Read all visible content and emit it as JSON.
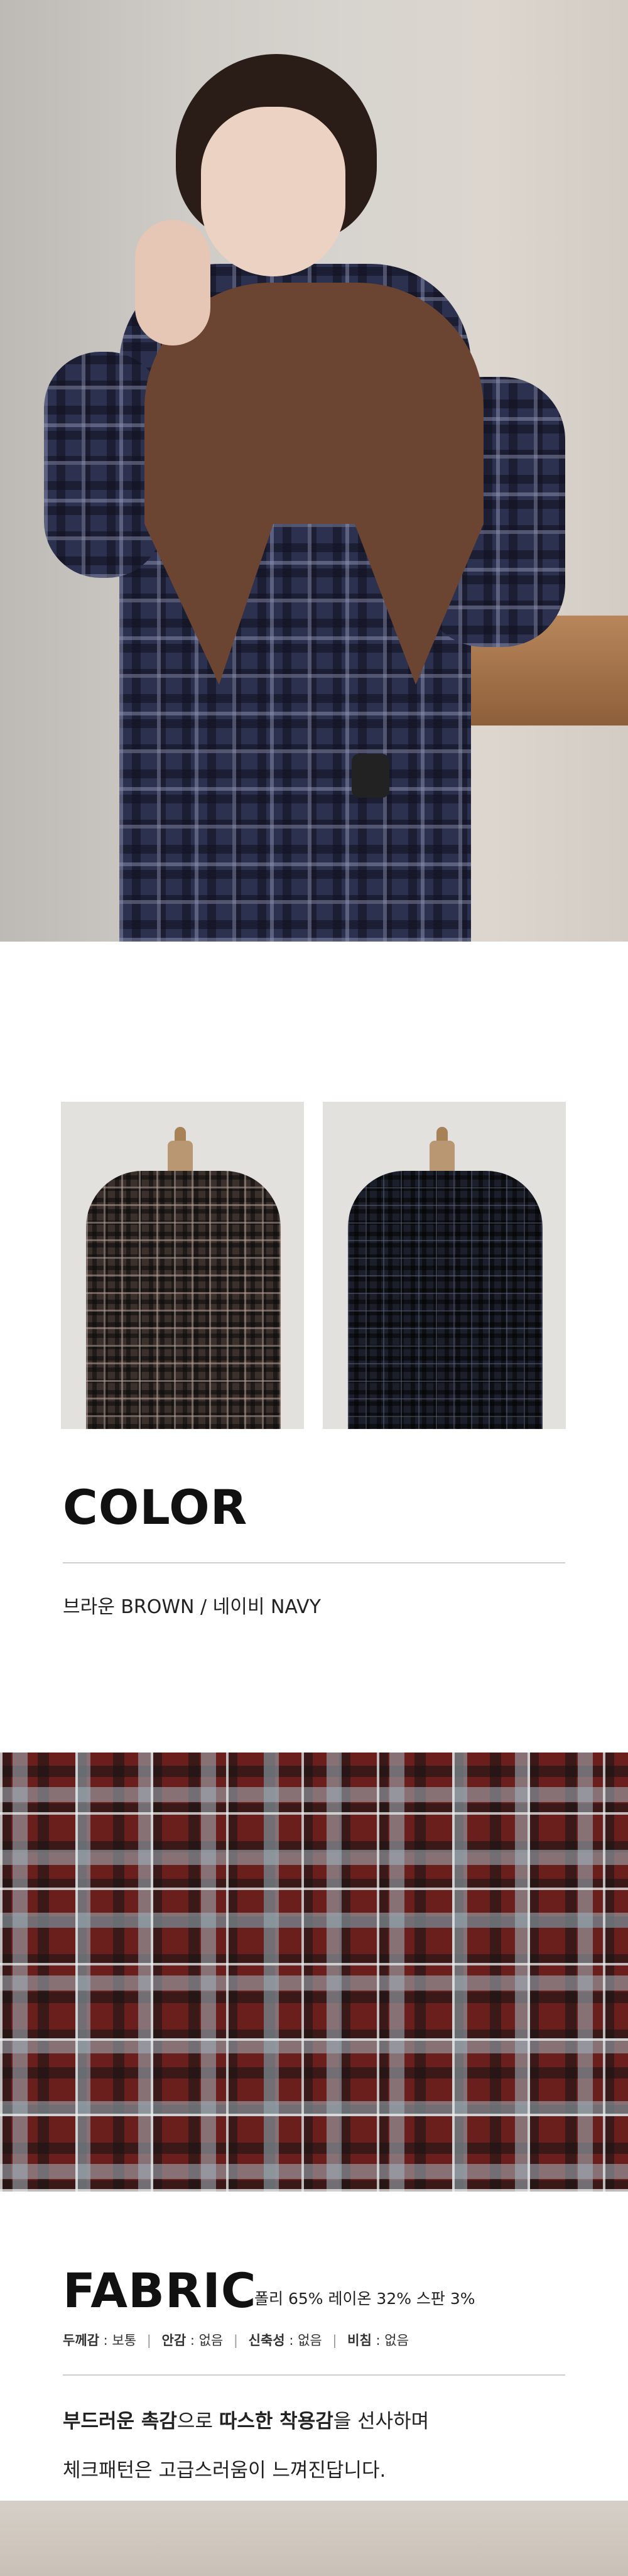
{
  "color_section": {
    "title": "COLOR",
    "options": "브라운 BROWN / 네이비 NAVY"
  },
  "fabric_section": {
    "title": "FABRIC",
    "composition": "폴리 65% 레이온 32% 스판 3%",
    "specs": [
      {
        "label": "두께감",
        "value": "보통"
      },
      {
        "label": "안감",
        "value": "없음"
      },
      {
        "label": "신축성",
        "value": "없음"
      },
      {
        "label": "비침",
        "value": "없음"
      }
    ],
    "desc_line1": {
      "p1_bold": "부드러운 촉감",
      "p2": "으로 ",
      "p3_bold": "따스한 착용감",
      "p4": "을 선사하며"
    },
    "desc_line2": "체크패턴은 고급스러움이 느껴진답니다."
  },
  "colors": {
    "brown": "#3b302b",
    "navy": "#1b1f2b",
    "fabric_red": "#6a1f1c"
  }
}
